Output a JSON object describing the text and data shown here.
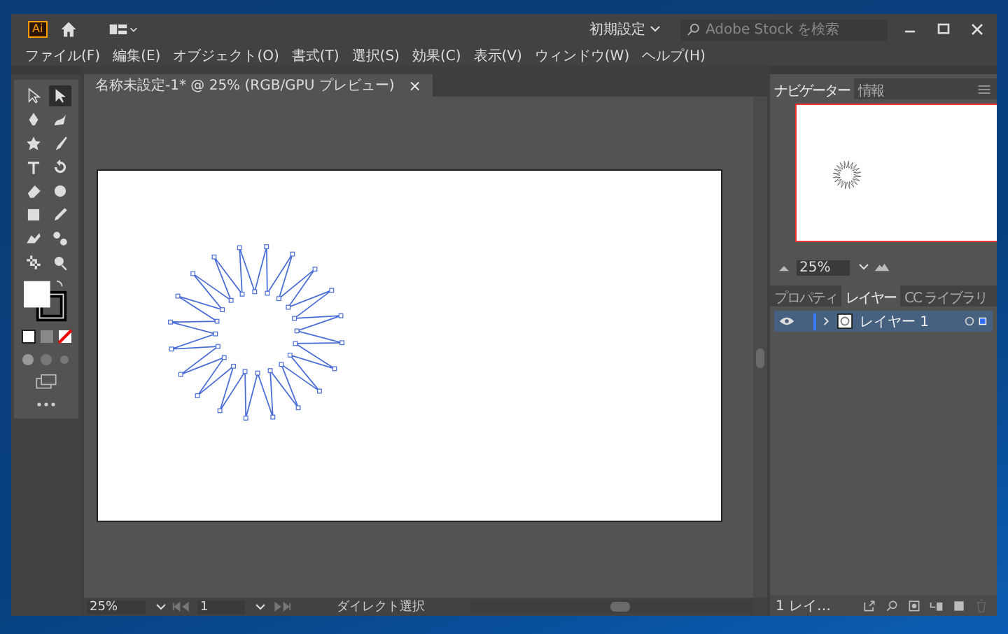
{
  "window": {
    "app_badge": "Ai",
    "workspace": "初期設定",
    "search": {
      "placeholder": "Adobe Stock を検索"
    }
  },
  "menu": [
    "ファイル(F)",
    "編集(E)",
    "オブジェクト(O)",
    "書式(T)",
    "選択(S)",
    "効果(C)",
    "表示(V)",
    "ウィンドウ(W)",
    "ヘルプ(H)"
  ],
  "document_tab": {
    "title": "名称未設定-1* @ 25% (RGB/GPU プレビュー)",
    "close": "×"
  },
  "tools": [
    {
      "kind": "selection",
      "selected": false
    },
    {
      "kind": "direct",
      "selected": true
    },
    {
      "kind": "pen",
      "selected": false
    },
    {
      "kind": "curvature",
      "selected": false
    },
    {
      "kind": "star",
      "selected": false
    },
    {
      "kind": "brush",
      "selected": false
    },
    {
      "kind": "type",
      "selected": false
    },
    {
      "kind": "rotate",
      "selected": false
    },
    {
      "kind": "eraser",
      "selected": false
    },
    {
      "kind": "shape-builder",
      "selected": false
    },
    {
      "kind": "gradient",
      "selected": false
    },
    {
      "kind": "eyedropper",
      "selected": false
    },
    {
      "kind": "puppet",
      "selected": false
    },
    {
      "kind": "blend",
      "selected": false
    },
    {
      "kind": "artboard",
      "selected": false
    },
    {
      "kind": "zoom",
      "selected": false
    }
  ],
  "navigator": {
    "tabs": [
      {
        "label": "ナビゲーター",
        "selected": true
      },
      {
        "label": "情報",
        "selected": false
      }
    ],
    "zoom": "25%"
  },
  "layers_panel": {
    "tabs": [
      {
        "label": "プロパティ",
        "selected": false
      },
      {
        "label": "レイヤー",
        "selected": true
      },
      {
        "label": "CC ライブラリ",
        "selected": false
      }
    ],
    "layers": [
      {
        "name": "レイヤー 1",
        "visible": true,
        "expanded": false,
        "selected": true
      }
    ],
    "footer": "1 レイ…"
  },
  "status_bar": {
    "zoom": "25%",
    "artboard": "1",
    "tool": "ダイレクト選択"
  }
}
